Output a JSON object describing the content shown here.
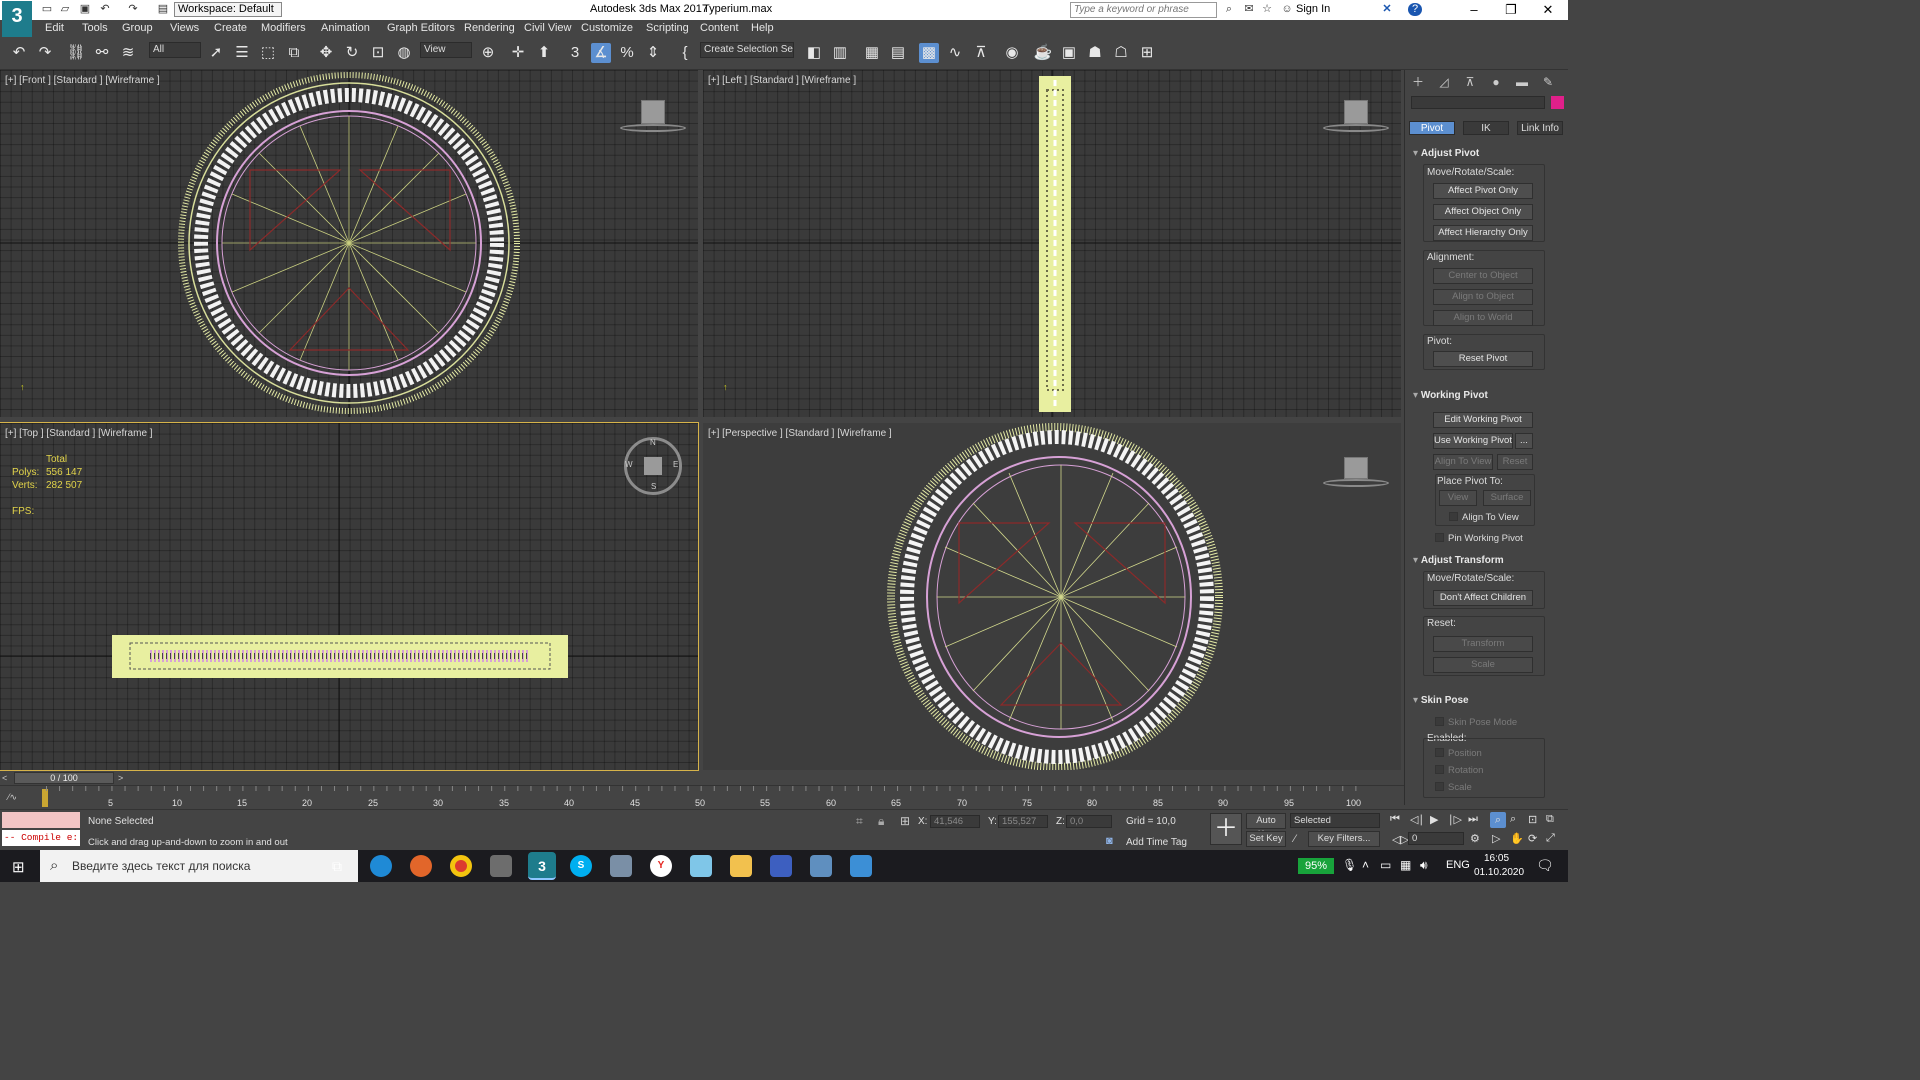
{
  "titlebar": {
    "logo": "3",
    "workspace": "Workspace: Default",
    "app_title": "Autodesk 3ds Max 2017",
    "file_title": "Typerium.max",
    "search_placeholder": "Type a keyword or phrase",
    "sign_in": "Sign In"
  },
  "menu": [
    "Edit",
    "Tools",
    "Group",
    "Views",
    "Create",
    "Modifiers",
    "Animation",
    "Graph Editors",
    "Rendering",
    "Civil View",
    "Customize",
    "Scripting",
    "Content",
    "Help"
  ],
  "toolbar": {
    "filter": "All",
    "ref_coord": "View",
    "selection_set": "Create Selection Se"
  },
  "viewports": {
    "front": {
      "label": "[+] [Front ] [Standard ] [Wireframe ]"
    },
    "left": {
      "label": "[+] [Left ] [Standard ] [Wireframe ]"
    },
    "top": {
      "label": "[+] [Top ] [Standard ] [Wireframe ]",
      "stats_total": "Total",
      "polys_label": "Polys:",
      "polys_value": "556 147",
      "verts_label": "Verts:",
      "verts_value": "282 507",
      "fps_label": "FPS:",
      "compass": {
        "n": "N",
        "s": "S",
        "e": "E",
        "w": "W"
      }
    },
    "perspective": {
      "label": "[+] [Perspective ] [Standard ] [Wireframe ]"
    }
  },
  "command_panel": {
    "tabs": {
      "pivot": "Pivot",
      "ik": "IK",
      "link_info": "Link Info"
    },
    "adjust_pivot": {
      "title": "Adjust Pivot",
      "move_label": "Move/Rotate/Scale:",
      "affect_pivot": "Affect Pivot Only",
      "affect_object": "Affect Object Only",
      "affect_hierarchy": "Affect Hierarchy Only",
      "alignment_label": "Alignment:",
      "center_to_object": "Center to Object",
      "align_to_object": "Align to Object",
      "align_to_world": "Align to World",
      "pivot_label": "Pivot:",
      "reset_pivot": "Reset Pivot"
    },
    "working_pivot": {
      "title": "Working Pivot",
      "edit_working_pivot": "Edit Working Pivot",
      "use_working_pivot": "Use Working Pivot",
      "more": "...",
      "align_to_view": "Align To View",
      "reset": "Reset",
      "place_pivot_label": "Place Pivot To:",
      "view": "View",
      "surface": "Surface",
      "align_to_view_chk": "Align To View",
      "pin_working_pivot": "Pin Working Pivot"
    },
    "adjust_transform": {
      "title": "Adjust Transform",
      "move_label": "Move/Rotate/Scale:",
      "dont_affect_children": "Don't Affect Children",
      "reset_label": "Reset:",
      "transform": "Transform",
      "scale": "Scale"
    },
    "skin_pose": {
      "title": "Skin Pose",
      "skin_pose_mode": "Skin Pose Mode",
      "enabled_label": "Enabled:",
      "position": "Position",
      "rotation": "Rotation",
      "scale": "Scale"
    }
  },
  "timeline": {
    "frame": "0 / 100",
    "ticks": [
      "5",
      "10",
      "15",
      "20",
      "25",
      "30",
      "35",
      "40",
      "45",
      "50",
      "55",
      "60",
      "65",
      "70",
      "75",
      "80",
      "85",
      "90",
      "95",
      "100"
    ],
    "start_marker": "0"
  },
  "status": {
    "maxscript": "-- Compile e:",
    "selection": "None Selected",
    "prompt": "Click and drag up-and-down to zoom in and out",
    "x_label": "X:",
    "x_value": "41,546",
    "y_label": "Y:",
    "y_value": "155,527",
    "z_label": "Z:",
    "z_value": "0,0",
    "grid": "Grid = 10,0",
    "add_time_tag": "Add Time Tag",
    "auto_key": "Auto Key",
    "set_key": "Set Key",
    "selected": "Selected",
    "key_filters": "Key Filters...",
    "frame_field": "0"
  },
  "taskbar": {
    "search_placeholder": "Введите здесь текст для поиска",
    "battery": "95%",
    "language": "ENG",
    "time": "16:05",
    "date": "01.10.2020"
  }
}
